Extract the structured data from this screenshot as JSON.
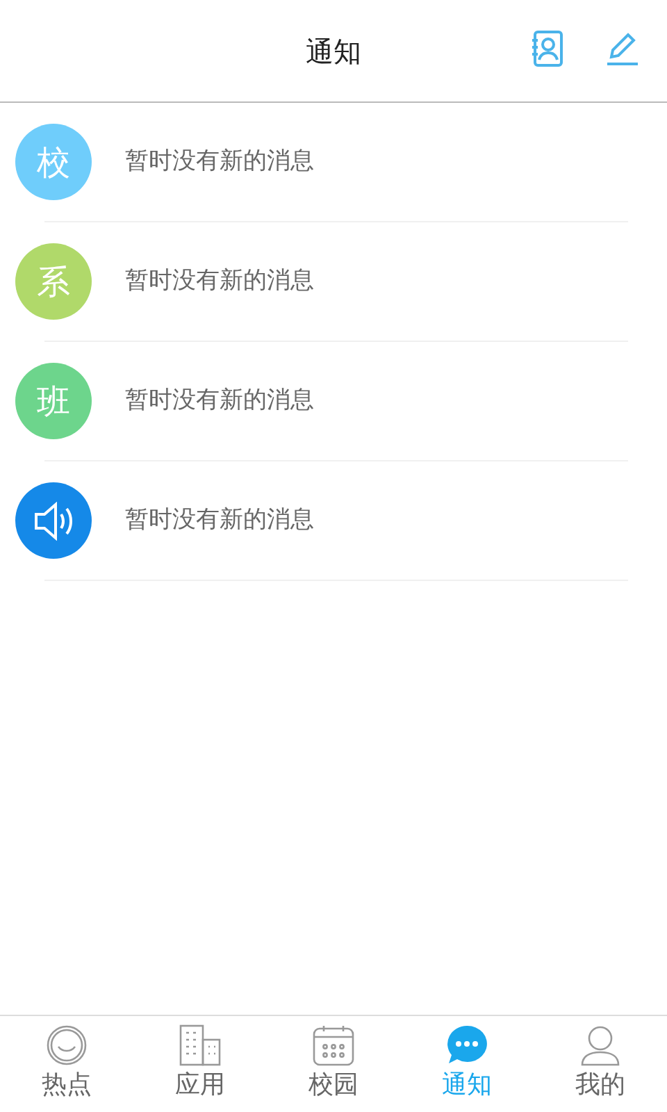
{
  "header": {
    "title": "通知"
  },
  "notices": [
    {
      "kind": "text",
      "avatar": "校",
      "color": "#6fcdfb",
      "message": "暂时没有新的消息"
    },
    {
      "kind": "text",
      "avatar": "系",
      "color": "#b0d96a",
      "message": "暂时没有新的消息"
    },
    {
      "kind": "text",
      "avatar": "班",
      "color": "#6dd58c",
      "message": "暂时没有新的消息"
    },
    {
      "kind": "speaker",
      "color": "#1589e8",
      "message": "暂时没有新的消息"
    }
  ],
  "tabs": [
    {
      "kind": "smile",
      "label": "热点",
      "selected": false
    },
    {
      "kind": "buildings",
      "label": "应用",
      "selected": false
    },
    {
      "kind": "calendar",
      "label": "校园",
      "selected": false
    },
    {
      "kind": "chat",
      "label": "通知",
      "selected": true
    },
    {
      "kind": "person",
      "label": "我的",
      "selected": false
    }
  ]
}
